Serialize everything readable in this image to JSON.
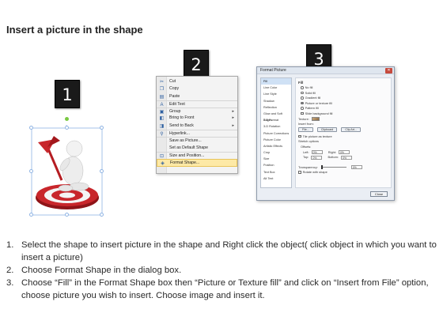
{
  "title": "Insert a picture in the shape",
  "steps": [
    {
      "number": "1"
    },
    {
      "number": "2"
    },
    {
      "number": "3"
    }
  ],
  "context_menu": {
    "items": [
      {
        "label": "Cut",
        "icon": "scissors-icon",
        "glyph": "✂"
      },
      {
        "label": "Copy",
        "icon": "copy-icon",
        "glyph": "❐"
      },
      {
        "label": "Paste",
        "icon": "paste-icon",
        "glyph": "▤"
      },
      {
        "label": "Edit Text",
        "icon": "edit-text-icon",
        "glyph": "A"
      },
      {
        "label": "Group",
        "icon": "group-icon",
        "glyph": "▣",
        "submenu": true
      },
      {
        "label": "Bring to Front",
        "icon": "bring-front-icon",
        "glyph": "◧",
        "submenu": true
      },
      {
        "label": "Send to Back",
        "icon": "send-back-icon",
        "glyph": "◨",
        "submenu": true
      },
      {
        "label": "Hyperlink...",
        "icon": "hyperlink-icon",
        "glyph": "⚲"
      },
      {
        "label": "Save as Picture...",
        "icon": "",
        "glyph": ""
      },
      {
        "label": "Set as Default Shape",
        "icon": "",
        "glyph": ""
      },
      {
        "label": "Size and Position...",
        "icon": "size-position-icon",
        "glyph": "⊡"
      },
      {
        "label": "Format Shape...",
        "icon": "format-shape-icon",
        "glyph": "◈",
        "highlighted": true
      }
    ]
  },
  "dialog": {
    "title": "Format Picture",
    "close_glyph": "✕",
    "nav_items": [
      "Fill",
      "Line Color",
      "Line Style",
      "Shadow",
      "Reflection",
      "Glow and Soft Edges",
      "3-D Format",
      "3-D Rotation",
      "Picture Corrections",
      "Picture Color",
      "Artistic Effects",
      "Crop",
      "Size",
      "Position",
      "Text Box",
      "Alt Text"
    ],
    "section_head": "Fill",
    "fill_options": [
      "No fill",
      "Solid fill",
      "Gradient fill",
      "Picture or texture fill",
      "Pattern fill",
      "Slide background fill"
    ],
    "texture_label": "Texture:",
    "insert_from_label": "Insert from:",
    "buttons": [
      "File...",
      "Clipboard",
      "Clip Art..."
    ],
    "tile_label": "Tile picture as texture",
    "stretch_label": "Stretch options",
    "offsets_label": "Offsets:",
    "left_label": "Left:",
    "right_label": "Right:",
    "top_label": "Top:",
    "bottom_label": "Bottom:",
    "offset_value": "0%",
    "transparency_label": "Transparency:",
    "transparency_value": "0%",
    "rotate_label": "Rotate with shape",
    "close_label": "Close"
  },
  "instructions": [
    {
      "num": "1.",
      "text": "Select the shape to insert picture in the shape and Right click the object( click object in which you want to insert a picture)"
    },
    {
      "num": "2.",
      "text": "Choose Format Shape in the dialog box."
    },
    {
      "num": "3.",
      "text": "Choose “Fill” in the Format Shape box then “Picture or Texture fill”  and click on “Insert from File” option, choose picture you wish to insert. Choose image and insert it."
    }
  ],
  "colors": {
    "badge": "#1a1a1a",
    "target_red": "#c8262b",
    "menu_highlight": "#fde9a6",
    "selection_handle": "#8fb4e3",
    "rotate_handle": "#7ac943"
  }
}
